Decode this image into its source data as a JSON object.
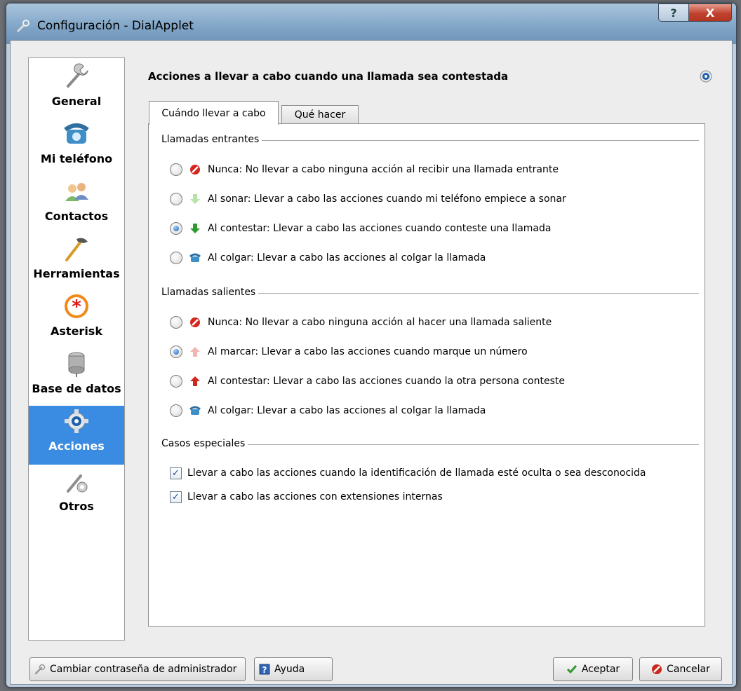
{
  "window": {
    "title": "Configuración - DialApplet",
    "help_glyph": "?",
    "close_glyph": "X"
  },
  "sidebar": {
    "items": [
      {
        "label": "General",
        "icon": "wrench-icon"
      },
      {
        "label": "Mi teléfono",
        "icon": "phone-icon"
      },
      {
        "label": "Contactos",
        "icon": "contacts-icon"
      },
      {
        "label": "Herramientas",
        "icon": "hammer-icon"
      },
      {
        "label": "Asterisk",
        "icon": "asterisk-icon"
      },
      {
        "label": "Base de datos",
        "icon": "database-icon"
      },
      {
        "label": "Acciones",
        "icon": "gear-icon",
        "selected": true
      },
      {
        "label": "Otros",
        "icon": "tools-icon"
      }
    ]
  },
  "main": {
    "heading": "Acciones a llevar a cabo cuando una llamada sea contestada",
    "tabs": [
      {
        "label": "Cuándo llevar a cabo",
        "active": true
      },
      {
        "label": "Qué hacer",
        "active": false
      }
    ],
    "incoming": {
      "title": "Llamadas entrantes",
      "options": [
        {
          "label": "Nunca: No llevar a cabo ninguna acción al recibir una llamada entrante",
          "icon": "no-entry-icon",
          "selected": false
        },
        {
          "label": "Al sonar: Llevar a cabo las acciones cuando mi teléfono empiece a sonar",
          "icon": "light-green-down-arrow-icon",
          "selected": false
        },
        {
          "label": "Al contestar: Llevar a cabo las acciones cuando conteste una llamada",
          "icon": "green-down-arrow-icon",
          "selected": true
        },
        {
          "label": "Al colgar: Llevar a cabo las acciones al colgar la llamada",
          "icon": "phone-icon",
          "selected": false
        }
      ]
    },
    "outgoing": {
      "title": "Llamadas salientes",
      "options": [
        {
          "label": "Nunca: No llevar a cabo ninguna acción al hacer una llamada saliente",
          "icon": "no-entry-icon",
          "selected": false
        },
        {
          "label": "Al marcar: Llevar a cabo las acciones cuando marque un número",
          "icon": "light-red-up-arrow-icon",
          "selected": true
        },
        {
          "label": "Al contestar: Llevar a cabo las acciones cuando la otra persona conteste",
          "icon": "red-up-arrow-icon",
          "selected": false
        },
        {
          "label": "Al colgar: Llevar a cabo las acciones al colgar la llamada",
          "icon": "phone-icon",
          "selected": false
        }
      ]
    },
    "special": {
      "title": "Casos especiales",
      "options": [
        {
          "label": "Llevar a cabo las acciones cuando la identificación de llamada esté oculta o sea desconocida",
          "checked": true
        },
        {
          "label": "Llevar a cabo las acciones con extensiones internas",
          "checked": true
        }
      ]
    }
  },
  "buttons": {
    "change_password": "Cambiar contraseña de administrador",
    "help": "Ayuda",
    "accept": "Aceptar",
    "cancel": "Cancelar"
  },
  "colors": {
    "selection": "#3a8be2",
    "accept_check": "#2e9a2e",
    "cancel_red": "#c8281e"
  }
}
